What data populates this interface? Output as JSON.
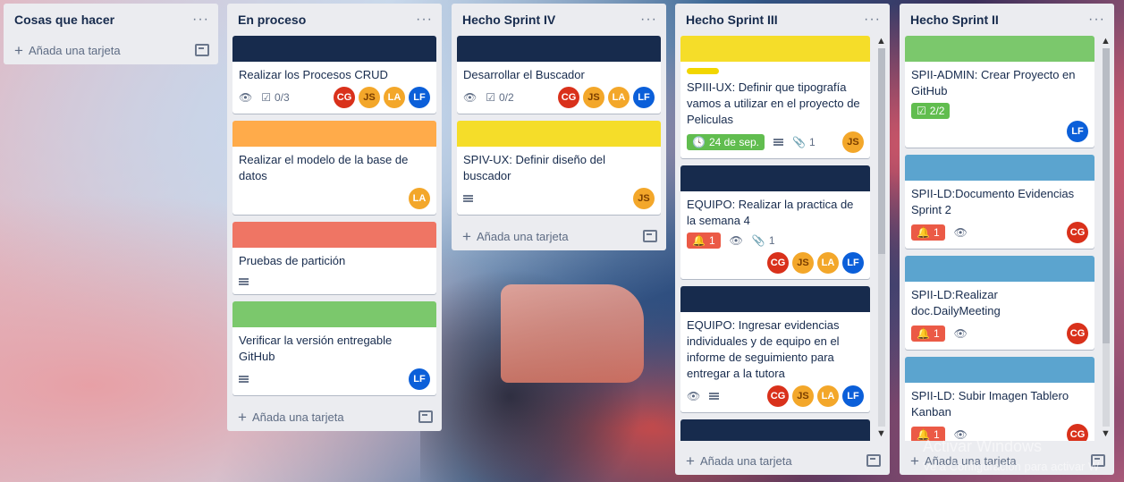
{
  "lists": [
    {
      "title": "Cosas que hacer",
      "add_label": "Añada una tarjeta"
    },
    {
      "title": "En proceso",
      "add_label": "Añada una tarjeta"
    },
    {
      "title": "Hecho Sprint IV",
      "add_label": "Añada una tarjeta"
    },
    {
      "title": "Hecho Sprint III",
      "add_label": "Añada una tarjeta"
    },
    {
      "title": "Hecho Sprint II",
      "add_label": "Añada una tarjeta"
    }
  ],
  "cards": {
    "p1": {
      "title": "Realizar los Procesos CRUD",
      "checklist": "0/3",
      "members": [
        "CG",
        "JS",
        "LA",
        "LF"
      ],
      "cover": "#172b4d"
    },
    "p2": {
      "title": "Realizar el modelo de la base de datos",
      "members": [
        "LA"
      ],
      "cover": "#ffab4a"
    },
    "p3": {
      "title": "Pruebas de partición",
      "cover": "#ef7564"
    },
    "p4": {
      "title": "Verificar la versión entregable GitHub",
      "members": [
        "LF"
      ],
      "cover": "#7bc86c"
    },
    "s4a": {
      "title": "Desarrollar el Buscador",
      "checklist": "0/2",
      "members": [
        "CG",
        "JS",
        "LA",
        "LF"
      ],
      "cover": "#172b4d"
    },
    "s4b": {
      "title": "SPIV-UX: Definir diseño del buscador",
      "members": [
        "JS"
      ],
      "cover": "#f5dd29"
    },
    "s3a": {
      "title": "SPIII-UX: Definir que tipografía vamos a utilizar en el proyecto de Peliculas",
      "due": "24 de sep.",
      "attachments": "1",
      "members": [
        "JS"
      ],
      "cover": "#f5dd29"
    },
    "s3b": {
      "title": "EQUIPO: Realizar la practica de la semana 4",
      "notifications": "1",
      "attachments": "1",
      "members": [
        "CG",
        "JS",
        "LA",
        "LF"
      ],
      "cover": "#172b4d"
    },
    "s3c": {
      "title": "EQUIPO: Ingresar evidencias individuales y de equipo en el informe de seguimiento para entregar a la tutora",
      "members": [
        "CG",
        "JS",
        "LA",
        "LF"
      ],
      "cover": "#172b4d"
    },
    "s2a": {
      "title": "SPII-ADMIN: Crear Proyecto en GitHub",
      "checklist": "2/2",
      "members": [
        "LF"
      ],
      "cover": "#7bc86c"
    },
    "s2b": {
      "title": "SPII-LD:Documento Evidencias Sprint 2",
      "notifications": "1",
      "members": [
        "CG"
      ],
      "cover": "#5ba4cf"
    },
    "s2c": {
      "title": "SPII-LD:Realizar doc.DailyMeeting",
      "notifications": "1",
      "members": [
        "CG"
      ],
      "cover": "#5ba4cf"
    },
    "s2d": {
      "title": "SPII-LD: Subir Imagen Tablero Kanban",
      "notifications": "1",
      "members": [
        "CG"
      ],
      "cover": "#5ba4cf"
    }
  },
  "watermark": {
    "title": "Activar Windows",
    "subtitle": "Ve a Configuración para activar W"
  }
}
